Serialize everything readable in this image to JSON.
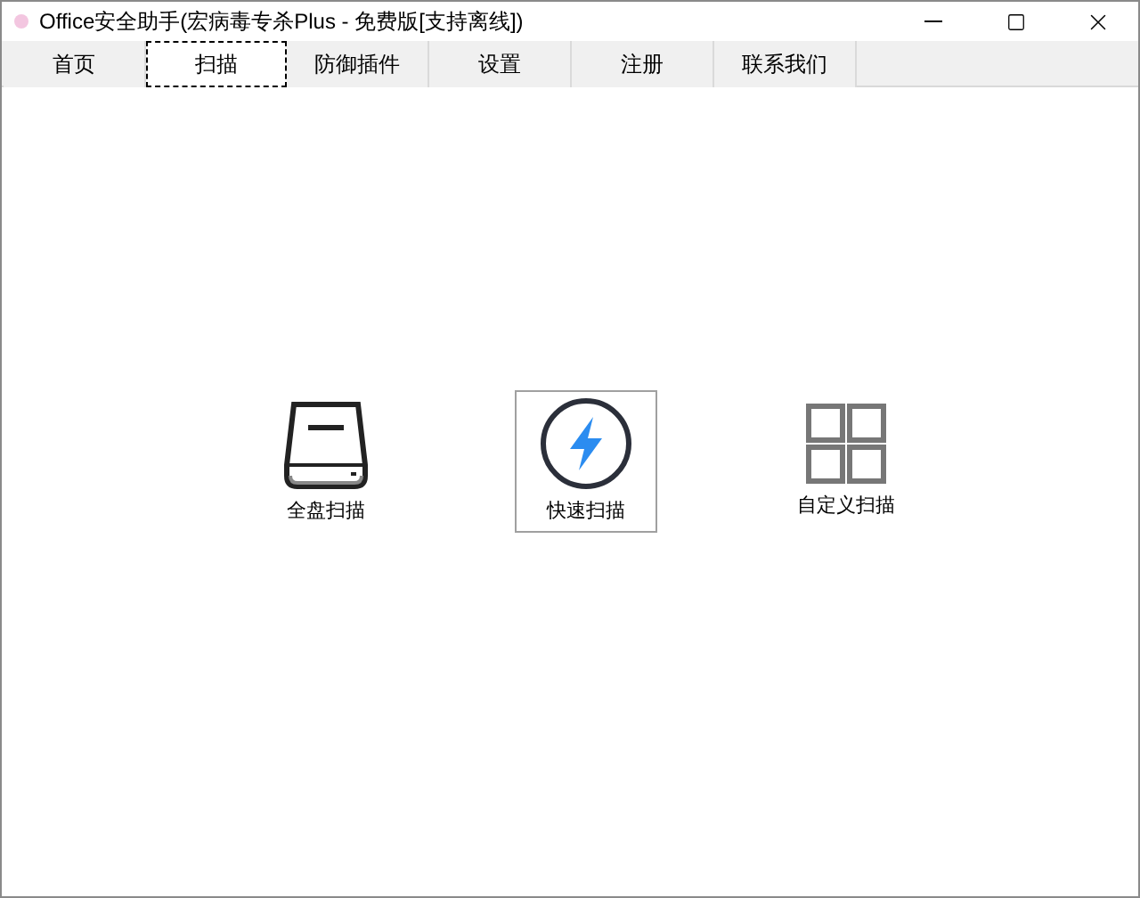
{
  "window": {
    "title": "Office安全助手(宏病毒专杀Plus - 免费版[支持离线])"
  },
  "tabs": [
    {
      "label": "首页",
      "selected": false
    },
    {
      "label": "扫描",
      "selected": true
    },
    {
      "label": "防御插件",
      "selected": false
    },
    {
      "label": "设置",
      "selected": false
    },
    {
      "label": "注册",
      "selected": false
    },
    {
      "label": "联系我们",
      "selected": false
    }
  ],
  "scan_options": [
    {
      "kind": "disk",
      "label": "全盘扫描",
      "selected": false
    },
    {
      "kind": "bolt",
      "label": "快速扫描",
      "selected": true
    },
    {
      "kind": "grid",
      "label": "自定义扫描",
      "selected": false
    }
  ]
}
